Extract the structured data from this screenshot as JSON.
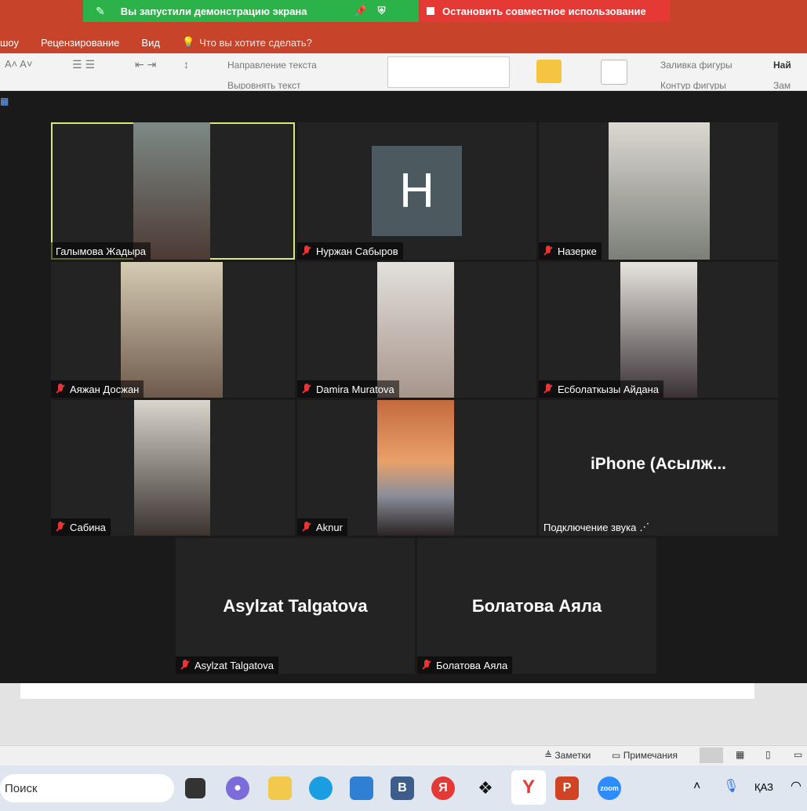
{
  "share_bar": {
    "status": "Вы запустили демонстрацию экрана",
    "stop": "Остановить совместное использование"
  },
  "ribbon": {
    "tabs": [
      "шоу",
      "Рецензирование",
      "Вид"
    ],
    "tell_me": "Что вы хотите сделать?",
    "text_direction": "Направление текста",
    "align_text": "Выровнять текст",
    "shape_fill": "Заливка фигуры",
    "shape_outline": "Контур фигуры",
    "find": "Най",
    "replace": "Зам"
  },
  "participants": [
    {
      "name": "Галымова Жадыра"
    },
    {
      "name": "Нуржан Сабыров",
      "initial": "Н"
    },
    {
      "name": "Назерке"
    },
    {
      "name": "Аяжан Досжан"
    },
    {
      "name": "Damira Muratova"
    },
    {
      "name": "Есболаткызы Айдана"
    },
    {
      "name": "Сабина"
    },
    {
      "name": "Aknur"
    },
    {
      "name": "iPhone  (Асылж...",
      "label": "Подключение звука"
    },
    {
      "name": "Asylzat Talgatova",
      "label": "Asylzat Talgatova"
    },
    {
      "name": "Болатова Аяла",
      "label": "Болатова Аяла"
    }
  ],
  "statusbar": {
    "notes": "Заметки",
    "comments": "Примечания"
  },
  "taskbar": {
    "search_placeholder": "Поиск",
    "language": "ҚАЗ"
  },
  "colors": {
    "ppt_red": "#c7442b",
    "share_green": "#2bb34a",
    "stop_red": "#e53935",
    "active_speaker": "#d9e87a"
  }
}
